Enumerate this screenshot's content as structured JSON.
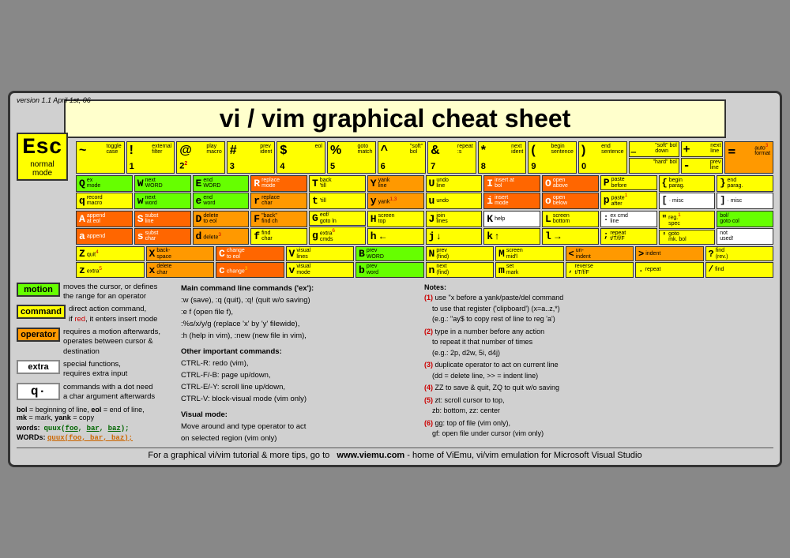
{
  "version": "version 1.1\nApril 1st, 06",
  "title": "vi / vim graphical cheat sheet",
  "esc": {
    "label": "Esc",
    "sub": "normal\nmode"
  },
  "footer": {
    "text": "For a graphical vi/vim tutorial & more tips, go to",
    "website": "www.viemu.com",
    "suffix": " - home of ViEmu, vi/vim emulation for Microsoft Visual Studio"
  },
  "legend": {
    "motion": "moves the cursor, or defines\nthe range for an operator",
    "command": "direct action command,\nif red, it enters insert mode",
    "operator": "requires a motion afterwards,\noperates between cursor &\ndestination",
    "extra": "special functions,\nrequires extra input",
    "dot": "commands with a dot need\na char argument afterwards",
    "bol": "bol = beginning of line, eol = end of line,",
    "mk": "mk = mark, yank = copy",
    "words": "words:",
    "words_example": "quux(foo, bar, baz);",
    "WORDS": "WORDs:",
    "WORDS_example": "quux(foo, bar, baz);"
  },
  "main_commands": {
    "title": "Main command line commands ('ex'):",
    "lines": [
      ":w (save), :q (quit), :q! (quit w/o saving)",
      ":e f (open file f),",
      ":%s/x/y/g (replace 'x' by 'y' filewide),",
      ":h (help in vim), :new (new file in vim),"
    ],
    "other_title": "Other important commands:",
    "other_lines": [
      "CTRL-R: redo (vim),",
      "CTRL-F/-B: page up/down,",
      "CTRL-E/-Y: scroll line up/down,",
      "CTRL-V: block-visual mode (vim only)"
    ],
    "visual_title": "Visual mode:",
    "visual_lines": [
      "Move around and type operator to act",
      "on selected region (vim only)"
    ]
  },
  "notes": {
    "title": "Notes:",
    "items": [
      "(1) use \"x before a yank/paste/del command\n    to use that register ('clipboard') (x=a..z,*)\n    (e.g.: \"ay$ to copy rest of line to reg 'a')",
      "(2) type in a number before any action\n    to repeat it that number of times\n    (e.g.: 2p, d2w, 5i, d4j)",
      "(3) duplicate operator to act on current line\n    (dd = delete line, >> = indent line)",
      "(4) ZZ to save & quit, ZQ to quit w/o saving",
      "(5) zt: scroll cursor to top,\n    zb: bottom, zz: center",
      "(6) gg: top of file (vim only),\n    gf: open file under cursor (vim only)"
    ]
  }
}
